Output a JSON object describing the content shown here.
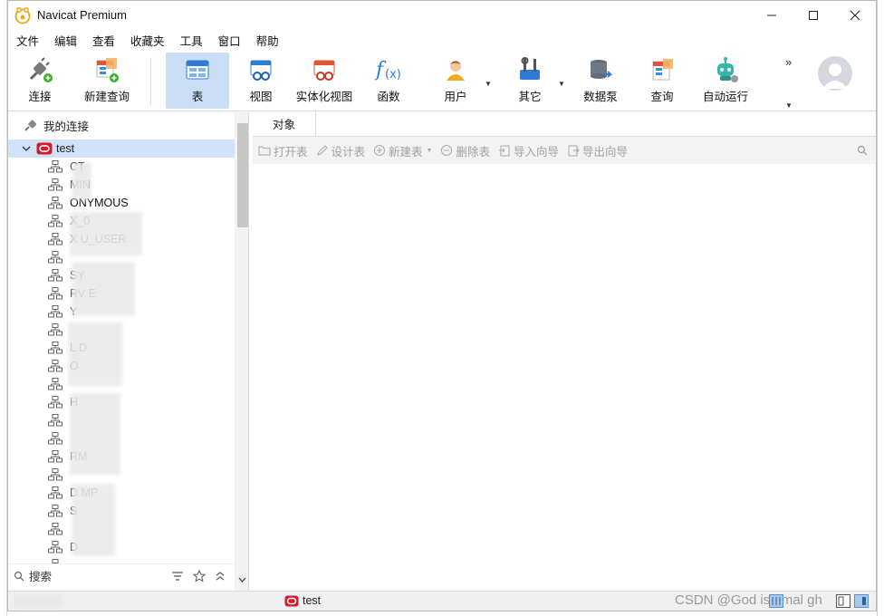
{
  "window": {
    "title": "Navicat Premium",
    "controls": {
      "minimize": "—",
      "maximize": "☐",
      "close": "✕"
    }
  },
  "menu": [
    "文件",
    "编辑",
    "查看",
    "收藏夹",
    "工具",
    "窗口",
    "帮助"
  ],
  "toolbar": {
    "connect": "连接",
    "new_query": "新建查询",
    "table": "表",
    "view": "视图",
    "materialized_view": "实体化视图",
    "function": "函数",
    "user": "用户",
    "other": "其它",
    "data_pump": "数据泵",
    "query": "查询",
    "autorun": "自动运行",
    "overflow": "»"
  },
  "sidebar": {
    "root": "我的连接",
    "connection": "test",
    "schemas": [
      "CT",
      "MIN",
      "ONYMOUS",
      "X_0",
      "X U_USER",
      "",
      "SY",
      "RV E",
      "Y",
      "",
      "L D",
      "O",
      "",
      "H",
      "",
      "",
      "RM",
      "",
      "D MP",
      "S",
      "",
      "D",
      ""
    ],
    "search_placeholder": "搜索"
  },
  "main": {
    "tab": "对象",
    "actions": {
      "open_table": "打开表",
      "design_table": "设计表",
      "new_table": "新建表",
      "delete_table": "删除表",
      "import_wizard": "导入向导",
      "export_wizard": "导出向导"
    }
  },
  "status": {
    "connection": "test",
    "watermark": "CSDN @God  is_ mal  gh"
  },
  "colors": {
    "selection": "#cfe2f7",
    "active_tool": "#c9def5",
    "oracle_red": "#d9182b"
  }
}
